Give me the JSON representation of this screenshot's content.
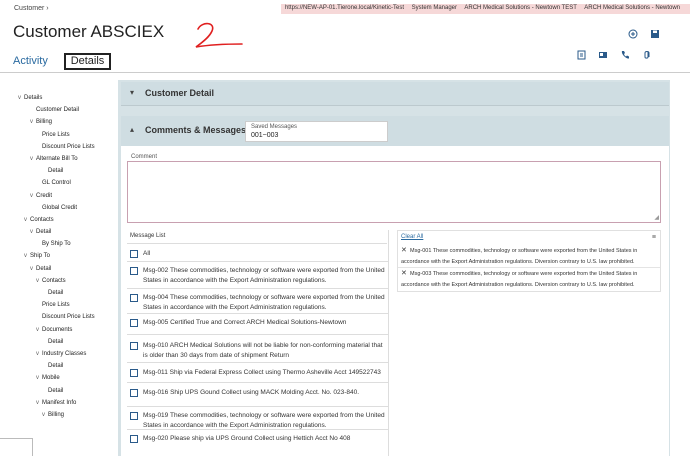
{
  "breadcrumb": {
    "label": "Customer",
    "sep": "›"
  },
  "topinfo": [
    "https://NEW-AP-01.Tierone.local/Kinetic-Test",
    "System Manager",
    "ARCH Medical Solutions - Newtown TEST",
    "ARCH Medical Solutions - Newtown"
  ],
  "page": {
    "title": "Customer ABSCIEX"
  },
  "tabs": {
    "activity": "Activity",
    "details": "Details"
  },
  "icons": {
    "header": [
      "add-icon",
      "save-icon"
    ],
    "sub": [
      "document-icon",
      "card-icon",
      "phone-icon",
      "attachment-icon"
    ]
  },
  "tree": [
    {
      "label": "Details",
      "caret": "v"
    },
    {
      "label": "Customer Detail",
      "caret": ""
    },
    {
      "label": "Billing",
      "caret": "v"
    },
    {
      "label": "Price Lists",
      "caret": ""
    },
    {
      "label": "Discount Price Lists",
      "caret": ""
    },
    {
      "label": "Alternate Bill To",
      "caret": "v"
    },
    {
      "label": "Detail",
      "caret": ""
    },
    {
      "label": "GL Control",
      "caret": ""
    },
    {
      "label": "Credit",
      "caret": "v"
    },
    {
      "label": "Global Credit",
      "caret": ""
    },
    {
      "label": "Contacts",
      "caret": "v"
    },
    {
      "label": "Detail",
      "caret": "v"
    },
    {
      "label": "By Ship To",
      "caret": ""
    },
    {
      "label": "Ship To",
      "caret": "v"
    },
    {
      "label": "Detail",
      "caret": "v"
    },
    {
      "label": "Contacts",
      "caret": "v"
    },
    {
      "label": "Detail",
      "caret": ""
    },
    {
      "label": "Price Lists",
      "caret": ""
    },
    {
      "label": "Discount Price Lists",
      "caret": ""
    },
    {
      "label": "Documents",
      "caret": "v"
    },
    {
      "label": "Detail",
      "caret": ""
    },
    {
      "label": "Industry Classes",
      "caret": "v"
    },
    {
      "label": "Detail",
      "caret": ""
    },
    {
      "label": "Mobile",
      "caret": "v"
    },
    {
      "label": "Detail",
      "caret": ""
    },
    {
      "label": "Manifest Info",
      "caret": "v"
    },
    {
      "label": "Billing",
      "caret": "v"
    }
  ],
  "sections": {
    "customer_detail": "Customer Detail",
    "comments": "Comments & Messages"
  },
  "saved_messages": {
    "label": "Saved Messages",
    "value": "001~003"
  },
  "comment": {
    "label": "Comment",
    "value": ""
  },
  "message_list": {
    "header": "Message List",
    "items": [
      "All",
      "Msg-002 These commodities, technology or software were exported from the United States in accordance with the Export Administration regulations.",
      "Msg-004 These commodities, technology or software were exported from the United States in accordance with the Export Administration regulations.",
      "Msg-005 Certified True and Correct ARCH Medical Solutions-Newtown",
      "Msg-010 ARCH Medical Solutions will not be liable for non-conforming material that is older than 30 days from date of shipment Return",
      "Msg-011 Ship via Federal Express Collect using Thermo Asheville Acct 149522743",
      "Msg-016 Ship UPS Gound Collect using MACK Molding Acct. No. 023-840.",
      "Msg-019 These commodities, technology or software were exported from the United States in accordance with the Export Administration regulations.",
      "Msg-020 Please ship via UPS Ground Collect using Hettich Acct No 408"
    ]
  },
  "selected": {
    "clear_label": "Clear All",
    "items": [
      "Msg-001 These commodities, technology or software were exported from the United States in accordance with the Export Administration regulations. Diversion contrary to U.S. law prohibited.",
      "Msg-003 These commodities, technology or software were exported from the United States in accordance with the Export Administration regulations. Diversion contrary to U.S. law prohibited."
    ]
  },
  "colors": {
    "accent": "#2a6aa0",
    "panel": "#d6e2e6",
    "scribble": "#e02020"
  }
}
